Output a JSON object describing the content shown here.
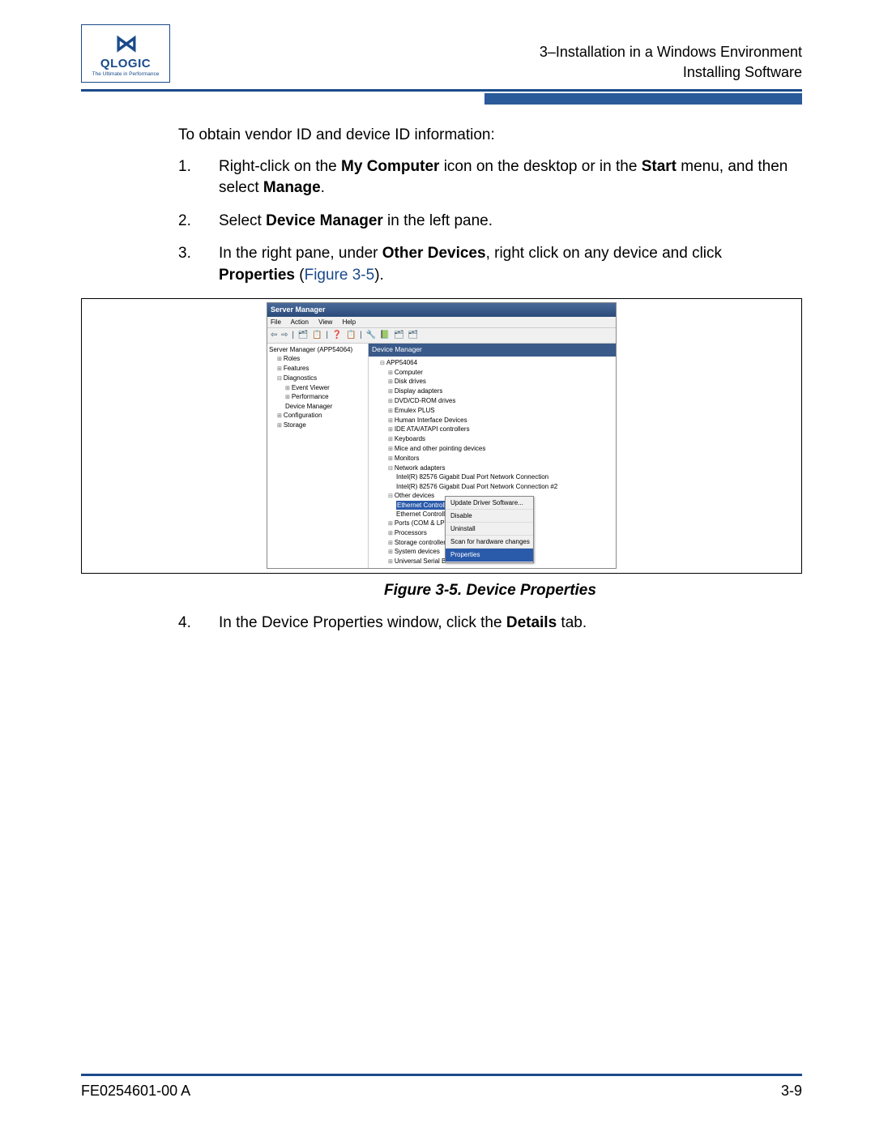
{
  "logo": {
    "glyph": "⋈",
    "brand": "QLOGIC",
    "tagline": "The Ultimate in Performance"
  },
  "header": {
    "line1": "3–Installation in a Windows Environment",
    "line2": "Installing Software"
  },
  "body": {
    "intro": "To obtain vendor ID and device ID information:",
    "steps": [
      {
        "num": "1.",
        "pre": "Right-click on the ",
        "b1": "My Computer",
        "mid1": " icon on the desktop or in the ",
        "b2": "Start",
        "mid2": " menu, and then select ",
        "b3": "Manage",
        "post": "."
      },
      {
        "num": "2.",
        "pre": "Select ",
        "b1": "Device Manager",
        "post": " in the left pane."
      },
      {
        "num": "3.",
        "pre": "In the right pane, under ",
        "b1": "Other Devices",
        "mid1": ", right click on any device and click ",
        "b2": "Properties",
        "mid2": " (",
        "link": "Figure 3-5",
        "post": ")."
      }
    ],
    "step4": {
      "num": "4.",
      "pre": "In the Device Properties window, click the ",
      "b1": "Details",
      "post": " tab."
    },
    "figcaption": "Figure 3-5. Device Properties"
  },
  "screenshot": {
    "title": "Server Manager",
    "menu": [
      "File",
      "Action",
      "View",
      "Help"
    ],
    "toolbar": "⇦ ⇨ | 🗂 📋 | ❓ 📋 | 🔧 📗 🗂 🗂",
    "left": {
      "root": "Server Manager (APP54064)",
      "items": [
        "Roles",
        "Features",
        "Diagnostics"
      ],
      "diag": [
        "Event Viewer",
        "Performance",
        "Device Manager"
      ],
      "after": [
        "Configuration",
        "Storage"
      ]
    },
    "right": {
      "head": "Device Manager",
      "root": "APP54064",
      "nodes": [
        "Computer",
        "Disk drives",
        "Display adapters",
        "DVD/CD-ROM drives",
        "Emulex PLUS",
        "Human Interface Devices",
        "IDE ATA/ATAPI controllers",
        "Keyboards",
        "Mice and other pointing devices",
        "Monitors",
        "Network adapters"
      ],
      "netadapters": [
        "Intel(R) 82576 Gigabit Dual Port Network Connection",
        "Intel(R) 82576 Gigabit Dual Port Network Connection #2"
      ],
      "other": "Other devices",
      "other_items": [
        "Ethernet Controller",
        "Ethernet Controller"
      ],
      "after": [
        "Ports (COM & LPT)",
        "Processors",
        "Storage controllers",
        "System devices",
        "Universal Serial Bus controllers"
      ]
    },
    "context": [
      "Update Driver Software...",
      "Disable",
      "Uninstall",
      "Scan for hardware changes",
      "Properties"
    ]
  },
  "footer": {
    "left": "FE0254601-00 A",
    "right": "3-9"
  }
}
